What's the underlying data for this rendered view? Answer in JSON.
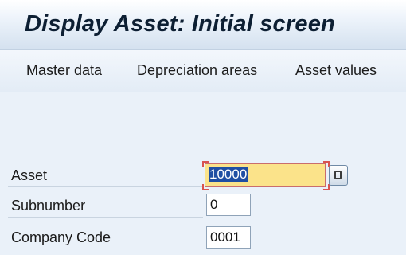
{
  "title": "Display Asset: Initial screen",
  "toolbar": {
    "master_data": "Master data",
    "depreciation_areas": "Depreciation areas",
    "asset_values": "Asset values"
  },
  "fields": {
    "asset": {
      "label": "Asset",
      "value": "10000"
    },
    "subnumber": {
      "label": "Subnumber",
      "value": "0"
    },
    "company_code": {
      "label": "Company Code",
      "value": "0001"
    }
  },
  "colors": {
    "focus_field_bg": "#fbe38a",
    "selection_bg": "#1f4fa3",
    "focus_corner": "#d9534f",
    "screen_bg": "#eaf1f9"
  },
  "icons": {
    "value_help": "value-help-icon"
  }
}
